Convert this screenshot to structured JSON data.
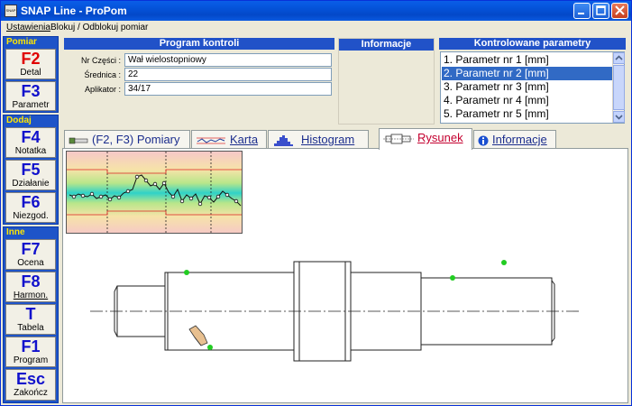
{
  "window": {
    "title": "SNAP Line - ProPom",
    "app_icon_text": "SNAP"
  },
  "menu": {
    "items": [
      "Ustawienia",
      "Blokuj / Odblokuj pomiar"
    ]
  },
  "sidebar": {
    "groups": [
      {
        "label": "Pomiar",
        "buttons": [
          {
            "key": "F2",
            "label": "Detal",
            "accent": "red"
          },
          {
            "key": "F3",
            "label": "Parametr"
          }
        ]
      },
      {
        "label": "Dodaj",
        "buttons": [
          {
            "key": "F4",
            "label": "Notatka"
          },
          {
            "key": "F5",
            "label": "Działanie"
          },
          {
            "key": "F6",
            "label": "Niezgod."
          }
        ]
      },
      {
        "label": "Inne",
        "buttons": [
          {
            "key": "F7",
            "label": "Ocena"
          },
          {
            "key": "F8",
            "label": "Harmon."
          },
          {
            "key": "T",
            "label": "Tabela"
          },
          {
            "key": "F1",
            "label": "Program"
          },
          {
            "key": "Esc",
            "label": "Zakończ"
          }
        ]
      }
    ]
  },
  "program_panel": {
    "title": "Program kontroli",
    "fields": [
      {
        "label": "Nr Części :",
        "value": "Wał wielostopniowy"
      },
      {
        "label": "Średnica :",
        "value": "22"
      },
      {
        "label": "Aplikator :",
        "value": "34/17"
      }
    ]
  },
  "info_panel": {
    "title": "Informacje"
  },
  "params_panel": {
    "title": "Kontrolowane parametry",
    "items": [
      "1. Parametr nr 1 [mm]",
      "2. Parametr nr 2 [mm]",
      "3. Parametr nr 3 [mm]",
      "4. Parametr nr 4 [mm]",
      "5. Parametr nr 5 [mm]"
    ],
    "selected_index": 1
  },
  "tabs": [
    {
      "label": "(F2, F3) Pomiary",
      "icon": "caliper-icon"
    },
    {
      "label": "Karta",
      "icon": "control-chart-icon"
    },
    {
      "label": "Histogram",
      "icon": "histogram-icon"
    },
    {
      "label": "Rysunek",
      "icon": "drawing-icon",
      "active": true
    },
    {
      "label": "Informacje",
      "icon": "info-icon"
    }
  ],
  "colors": {
    "title_bar": "#0452d8",
    "sidebar_group": "#1e54c8",
    "group_label": "#ffe600",
    "fkey_text": "#1111cc",
    "fkey_red": "#e00000",
    "panel_header": "#2152c8",
    "list_selection": "#316ac5",
    "active_tab": "#c4002f",
    "measure_point": "#22cc22"
  }
}
